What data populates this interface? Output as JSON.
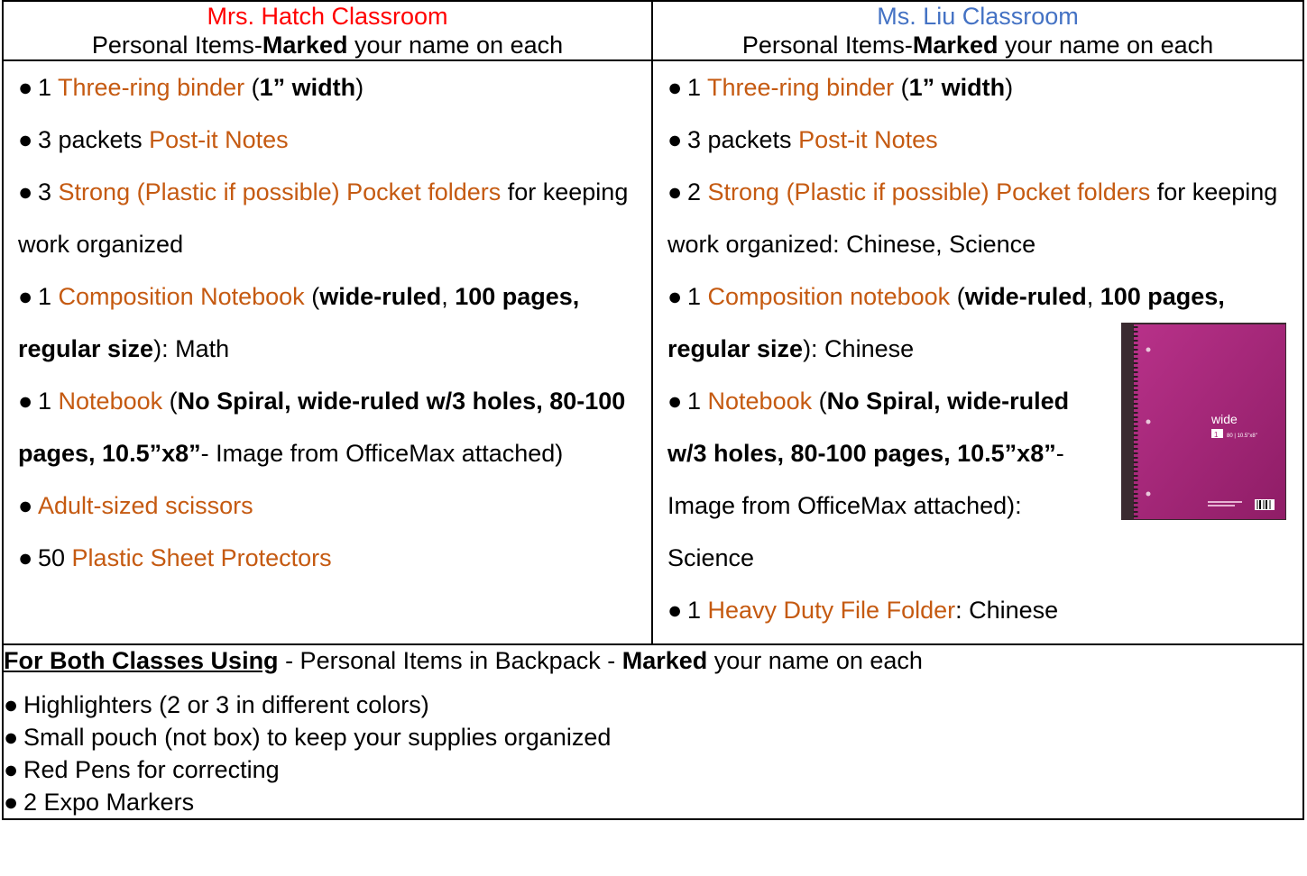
{
  "left": {
    "teacher": "Mrs. Hatch Classroom",
    "subtitle_pre": "Personal Items-",
    "subtitle_bold": "Marked",
    "subtitle_post": " your name on each",
    "items": [
      {
        "pre": "1 ",
        "item": "Three-ring binder",
        "rest": " (",
        "bold": "1” width",
        "post": ")"
      },
      {
        "pre": "3 packets ",
        "item": "Post-it Notes"
      },
      {
        "pre": "3 ",
        "item": "Strong (Plastic if possible) Pocket folders",
        "rest": " for keeping work organized"
      },
      {
        "pre": "1 ",
        "item": "Composition Notebook",
        "rest": " (",
        "bold": "wide-ruled",
        "mid": ", ",
        "bold2": "100 pages, regular size",
        "post": "): Math"
      },
      {
        "pre": "1 ",
        "item": "Notebook",
        "rest": " (",
        "bold": "No Spiral, wide-ruled w/3 holes, 80-100 pages, 10.5”x8”",
        "post": "- Image from OfficeMax attached)"
      },
      {
        "item": "Adult-sized scissors"
      },
      {
        "pre": "50 ",
        "item": "Plastic Sheet Protectors"
      }
    ]
  },
  "right": {
    "teacher": "Ms. Liu Classroom",
    "subtitle_pre": "Personal Items-",
    "subtitle_bold": "Marked",
    "subtitle_post": " your name on each",
    "items": [
      {
        "pre": "1 ",
        "item": "Three-ring binder",
        "rest": " (",
        "bold": "1” width",
        "post": ")"
      },
      {
        "pre": "3 packets ",
        "item": "Post-it Notes"
      },
      {
        "pre": "2 ",
        "item": "Strong (Plastic if possible) Pocket folders",
        "rest": " for keeping work organized: Chinese, Science"
      },
      {
        "pre": "1 ",
        "item": "Composition notebook",
        "rest": " (",
        "bold": "wide-ruled",
        "mid": ", ",
        "bold2": "100 pages, regular size",
        "post": "): Chinese"
      },
      {
        "pre": "1 ",
        "item": "Notebook",
        "rest": " (",
        "bold": "No Spiral, wide-ruled w/3 holes, 80-100 pages, 10.5”x8”",
        "post": "- Image from OfficeMax attached): Science"
      },
      {
        "pre": "1 ",
        "item": "Heavy Duty File Folder",
        "post": ": Chinese"
      }
    ],
    "notebook_cover_brand": "wide",
    "notebook_cover_count": "1",
    "notebook_cover_pages": "80 | 10.5\"x8\""
  },
  "both": {
    "heading": "For Both Classes Using",
    "sep": " - Personal Items in Backpack - ",
    "bold": "Marked",
    "post": " your name on each",
    "items": [
      "Highlighters (2 or 3 in different colors)",
      "Small pouch (not box) to keep your supplies organized",
      "Red Pens for correcting",
      "2 Expo Markers"
    ]
  },
  "colors": {
    "hatch": "#ff0000",
    "liu": "#4472c4",
    "item": "#c55a11"
  },
  "bullet": "●"
}
